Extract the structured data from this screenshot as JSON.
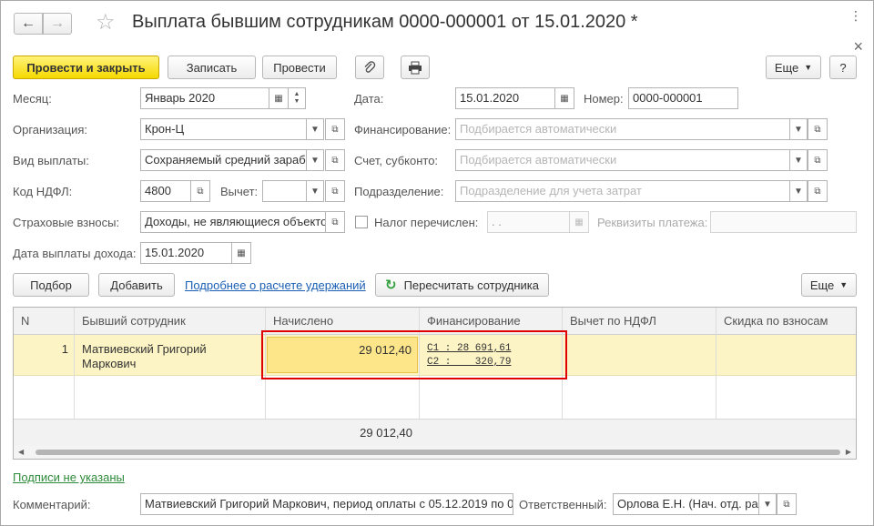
{
  "title": "Выплата бывшим сотрудникам 0000-000001 от 15.01.2020 *",
  "icons": {
    "back": "arrow-left-icon",
    "forward": "arrow-right-icon",
    "favorite": "star-icon",
    "more": "dots-icon",
    "close": "close-icon"
  },
  "toolbar": {
    "post_close": "Провести и закрыть",
    "save": "Записать",
    "post": "Провести",
    "more": "Еще",
    "help": "?"
  },
  "form": {
    "month_label": "Месяц:",
    "month_value": "Январь 2020",
    "date_label": "Дата:",
    "date_value": "15.01.2020",
    "number_label": "Номер:",
    "number_value": "0000-000001",
    "org_label": "Организация:",
    "org_value": "Крон-Ц",
    "financing_label": "Финансирование:",
    "financing_placeholder": "Подбирается автоматически",
    "pay_type_label": "Вид выплаты:",
    "pay_type_value": "Сохраняемый средний зараб",
    "account_label": "Счет, субконто:",
    "account_placeholder": "Подбирается автоматически",
    "ndfl_code_label": "Код НДФЛ:",
    "ndfl_code_value": "4800",
    "deduction_label": "Вычет:",
    "deduction_value": "",
    "department_label": "Подразделение:",
    "department_placeholder": "Подразделение для учета затрат",
    "insurance_label": "Страховые взносы:",
    "insurance_value": "Доходы, не являющиеся объекто",
    "tax_paid_label": "Налог перечислен:",
    "tax_paid_date": " .  .",
    "payment_details_label": "Реквизиты платежа:",
    "payment_details_value": "",
    "income_date_label": "Дата выплаты дохода:",
    "income_date_value": "15.01.2020"
  },
  "table_toolbar": {
    "select": "Подбор",
    "add": "Добавить",
    "details_link": "Подробнее о расчете удержаний",
    "recalc": "Пересчитать сотрудника",
    "more": "Еще"
  },
  "table": {
    "columns": [
      "N",
      "Бывший сотрудник",
      "Начислено",
      "Финансирование",
      "Вычет по НДФЛ",
      "Скидка по взносам"
    ],
    "rows": [
      {
        "n": "1",
        "employee_line1": "Матвиевский Григорий",
        "employee_line2": "Маркович",
        "accrued": "29 012,40",
        "fin_line1": "С1 : 28 691,61",
        "fin_line2": "С2 :    320,79",
        "ndfl_deduction": "",
        "discount": ""
      }
    ],
    "total_accrued": "29 012,40"
  },
  "footer": {
    "signatures_link": "Подписи не указаны",
    "comment_label": "Комментарий:",
    "comment_value": "Матвиевский Григорий Маркович, период оплаты с 05.12.2019 по 0",
    "responsible_label": "Ответственный:",
    "responsible_value": "Орлова Е.Н. (Нач. отд. ра"
  }
}
